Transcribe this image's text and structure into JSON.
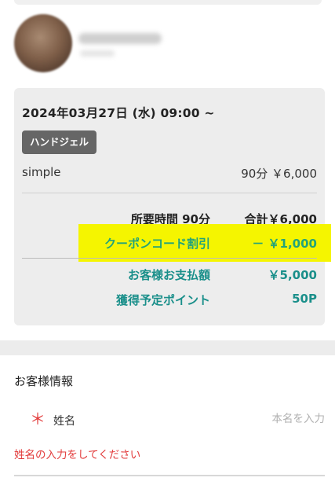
{
  "booking": {
    "datetime": "2024年03月27日 (水) 09:00 ~",
    "category_tag": "ハンドジェル",
    "menu_name": "simple",
    "menu_price": "90分 ￥6,000",
    "duration": "所要時間 90分",
    "total": "合計￥6,000",
    "coupon_label": "クーポンコード割引",
    "coupon_value": "－ ￥1,000",
    "payment_label": "お客様お支払額",
    "payment_value": "￥5,000",
    "points_label": "獲得予定ポイント",
    "points_value": "50P"
  },
  "customer": {
    "section_title": "お客様情報",
    "name_label": "姓名",
    "name_placeholder": "本名を入力",
    "name_error": "姓名の入力をしてください",
    "required_mark": "＊"
  },
  "colors": {
    "accent_green": "#22a37a",
    "accent_teal": "#1a8f8a",
    "error_red": "#e23b3b",
    "highlight_yellow": "#f5f500",
    "tag_gray": "#666666"
  }
}
